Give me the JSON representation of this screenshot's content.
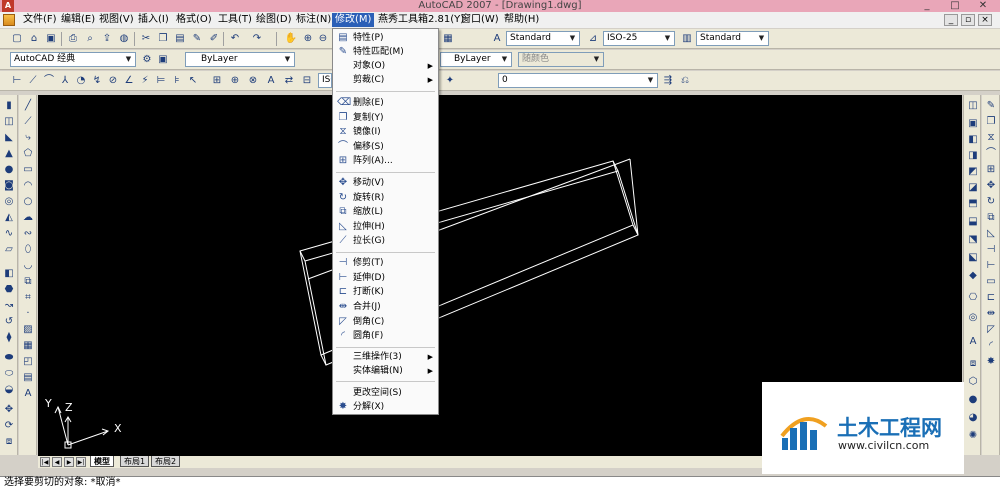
{
  "window": {
    "title": "AutoCAD 2007 - [Drawing1.dwg]",
    "app_badge": "A",
    "minimize": "_",
    "maximize": "□",
    "close": "✕"
  },
  "menubar": {
    "items": [
      {
        "label": "文件(F)"
      },
      {
        "label": "编辑(E)"
      },
      {
        "label": "视图(V)"
      },
      {
        "label": "插入(I)"
      },
      {
        "label": "格式(O)"
      },
      {
        "label": "工具(T)"
      },
      {
        "label": "绘图(D)"
      },
      {
        "label": "标注(N)"
      },
      {
        "label": "修改(M)"
      },
      {
        "label": "燕秀工具箱2.81(Y)"
      },
      {
        "label": "窗口(W)"
      },
      {
        "label": "帮助(H)"
      }
    ],
    "mdi_min": "_",
    "mdi_restore": "▫",
    "mdi_close": "×"
  },
  "toolbar": {
    "text_style": "Standard",
    "dim_style": "ISO-25",
    "table_style": "Standard",
    "workspace": "AutoCAD 经典",
    "layer_color": "ByLayer",
    "linetype": "ByLayer",
    "plot_style": "随颜色",
    "layer": "0",
    "iso_label": "ISO"
  },
  "modify_menu": {
    "items": [
      {
        "label": "特性(P)",
        "icon": "properties-icon",
        "glyph": "▤"
      },
      {
        "label": "特性匹配(M)",
        "icon": "match-brush-icon",
        "glyph": "✎"
      },
      {
        "label": "对象(O)",
        "submenu": true
      },
      {
        "label": "剪裁(C)",
        "submenu": true
      },
      {
        "label": "删除(E)",
        "icon": "eraser-icon",
        "glyph": "⌫"
      },
      {
        "label": "复制(Y)",
        "icon": "copy-icon",
        "glyph": "❐"
      },
      {
        "label": "镜像(I)",
        "icon": "mirror-icon",
        "glyph": "⧖"
      },
      {
        "label": "偏移(S)",
        "icon": "offset-icon",
        "glyph": "⌒"
      },
      {
        "label": "阵列(A)...",
        "icon": "array-icon",
        "glyph": "⊞"
      },
      {
        "label": "移动(V)",
        "icon": "move-icon",
        "glyph": "✥"
      },
      {
        "label": "旋转(R)",
        "icon": "rotate-icon",
        "glyph": "↻"
      },
      {
        "label": "缩放(L)",
        "icon": "scale-icon",
        "glyph": "⧉"
      },
      {
        "label": "拉伸(H)",
        "icon": "stretch-icon",
        "glyph": "◺"
      },
      {
        "label": "拉长(G)",
        "icon": "lengthen-icon",
        "glyph": "⟋"
      },
      {
        "label": "修剪(T)",
        "icon": "trim-icon",
        "glyph": "⊣"
      },
      {
        "label": "延伸(D)",
        "icon": "extend-icon",
        "glyph": "⊢"
      },
      {
        "label": "打断(K)",
        "icon": "break-icon",
        "glyph": "⊏"
      },
      {
        "label": "合并(J)",
        "icon": "join-icon",
        "glyph": "⇹"
      },
      {
        "label": "倒角(C)",
        "icon": "chamfer-icon",
        "glyph": "◸"
      },
      {
        "label": "圆角(F)",
        "icon": "fillet-icon",
        "glyph": "◜"
      },
      {
        "label": "三维操作(3)",
        "submenu": true
      },
      {
        "label": "实体编辑(N)",
        "submenu": true
      },
      {
        "label": "更改空间(S)"
      },
      {
        "label": "分解(X)",
        "icon": "explode-icon",
        "glyph": "✸"
      }
    ]
  },
  "layout_tabs": [
    {
      "label": "模型",
      "active": true
    },
    {
      "label": "布局1",
      "active": false
    },
    {
      "label": "布局2",
      "active": false
    }
  ],
  "ucs": {
    "x_label": "X",
    "y_label": "Y",
    "z_label": "Z"
  },
  "command_line": "选择要剪切的对象: *取消*",
  "watermark": {
    "title": "土木工程网",
    "url": "www.civilcn.com"
  },
  "colors": {
    "canvas_bg": "#000000",
    "menu_highlight": "#2b5fb7",
    "titlebar": "#e9a6b8",
    "wireframe": "#ffffff",
    "brand_blue": "#1a6fb6"
  }
}
